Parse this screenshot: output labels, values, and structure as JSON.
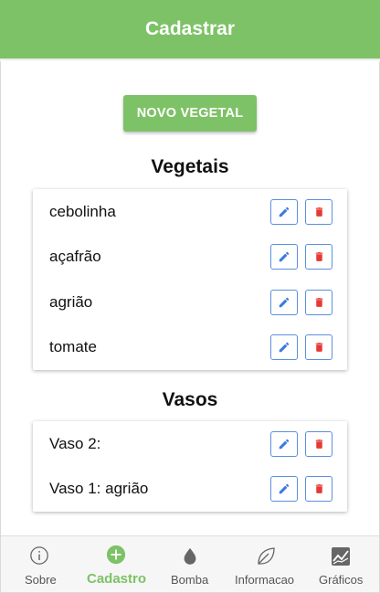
{
  "appbar": {
    "title": "Cadastrar"
  },
  "actions": {
    "new_button_label": "NOVO VEGETAL"
  },
  "vegetais": {
    "title": "Vegetais",
    "items": [
      {
        "label": "cebolinha"
      },
      {
        "label": "açafrão"
      },
      {
        "label": "agrião"
      },
      {
        "label": "tomate"
      }
    ]
  },
  "vasos": {
    "title": "Vasos",
    "items": [
      {
        "label": "Vaso 2:"
      },
      {
        "label": "Vaso 1: agrião"
      }
    ]
  },
  "icons": {
    "edit": "pencil-icon",
    "delete": "trash-icon"
  },
  "nav": {
    "tabs": [
      {
        "label": "Sobre",
        "icon": "info-icon",
        "active": false
      },
      {
        "label": "Cadastro",
        "icon": "add-circle-icon",
        "active": true
      },
      {
        "label": "Bomba",
        "icon": "water-drop-icon",
        "active": false
      },
      {
        "label": "Informacao",
        "icon": "leaf-icon",
        "active": false
      },
      {
        "label": "Gráficos",
        "icon": "chart-icon",
        "active": false
      }
    ]
  },
  "colors": {
    "primary": "#7dc266",
    "edit_icon": "#3b7ae0",
    "delete_icon": "#e53935",
    "button_border": "#5b8fe0"
  }
}
